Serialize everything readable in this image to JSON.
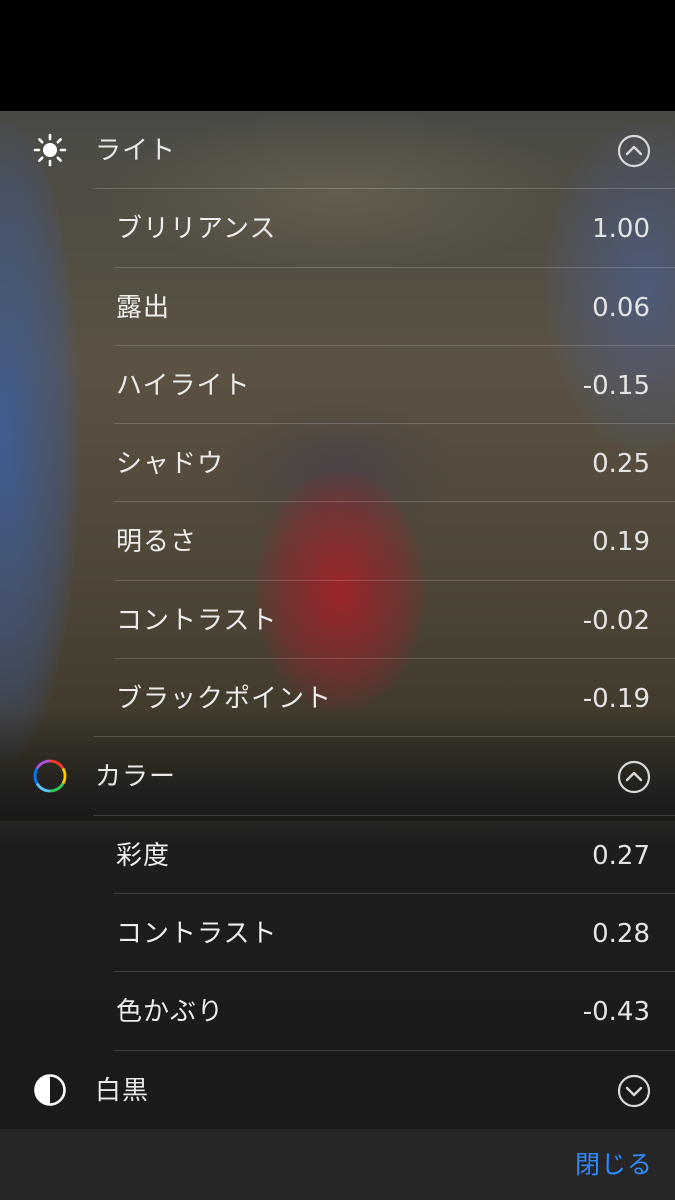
{
  "light": {
    "title": "ライト",
    "icon": "sun-icon",
    "toggle_icon": "chevron-up-circle-icon",
    "items": [
      {
        "label": "ブリリアンス",
        "value": "1.00"
      },
      {
        "label": "露出",
        "value": "0.06"
      },
      {
        "label": "ハイライト",
        "value": "-0.15"
      },
      {
        "label": "シャドウ",
        "value": "0.25"
      },
      {
        "label": "明るさ",
        "value": "0.19"
      },
      {
        "label": "コントラスト",
        "value": "-0.02"
      },
      {
        "label": "ブラックポイント",
        "value": "-0.19"
      }
    ]
  },
  "color": {
    "title": "カラー",
    "icon": "color-wheel-icon",
    "toggle_icon": "chevron-up-circle-icon",
    "items": [
      {
        "label": "彩度",
        "value": "0.27"
      },
      {
        "label": "コントラスト",
        "value": "0.28"
      },
      {
        "label": "色かぶり",
        "value": "-0.43"
      }
    ]
  },
  "bw": {
    "title": "白黒",
    "icon": "half-circle-icon",
    "toggle_icon": "chevron-down-circle-icon"
  },
  "footer": {
    "close_label": "閉じる",
    "accent_color": "#2f8cff"
  }
}
